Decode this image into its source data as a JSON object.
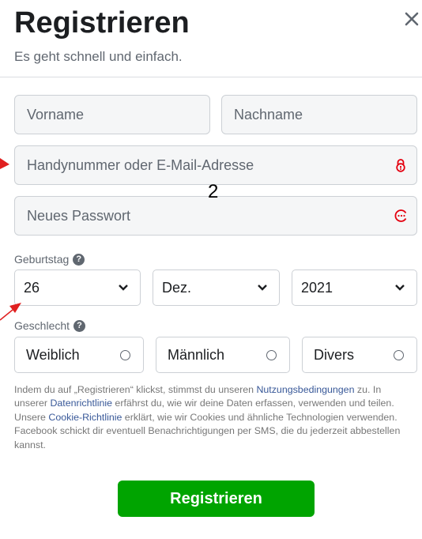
{
  "header": {
    "title": "Registrieren",
    "subtitle": "Es geht schnell und einfach.",
    "close_icon": "close-icon"
  },
  "form": {
    "first_name": {
      "placeholder": "Vorname"
    },
    "last_name": {
      "placeholder": "Nachname"
    },
    "contact": {
      "placeholder": "Handynummer oder E-Mail-Adresse",
      "icon": "warning-lock-icon"
    },
    "password": {
      "placeholder": "Neues Passwort",
      "icon": "password-warning-icon"
    },
    "birthday": {
      "label": "Geburtstag",
      "day": "26",
      "month": "Dez.",
      "year": "2021"
    },
    "gender": {
      "label": "Geschlecht",
      "options": [
        "Weiblich",
        "Männlich",
        "Divers"
      ]
    },
    "terms": {
      "t1": "Indem du auf „Registrieren“ klickst, stimmst du unseren ",
      "link1": "Nutzungsbedingungen",
      "t2": " zu. In unserer ",
      "link2": "Datenrichtlinie",
      "t3": " erfährst du, wie wir deine Daten erfassen, verwenden und teilen. Unsere ",
      "link3": "Cookie-Richtlinie",
      "t4": " erklärt, wie wir Cookies und ähnliche Technologien verwenden. Facebook schickt dir eventuell Benachrichtigungen per SMS, die du jederzeit abbestellen kannst."
    },
    "submit_label": "Registrieren"
  },
  "annotation": {
    "label": "2"
  },
  "colors": {
    "primary_button": "#00a400",
    "error": "#e4000f",
    "link": "#385898",
    "annotation_arrow": "#e02020"
  }
}
